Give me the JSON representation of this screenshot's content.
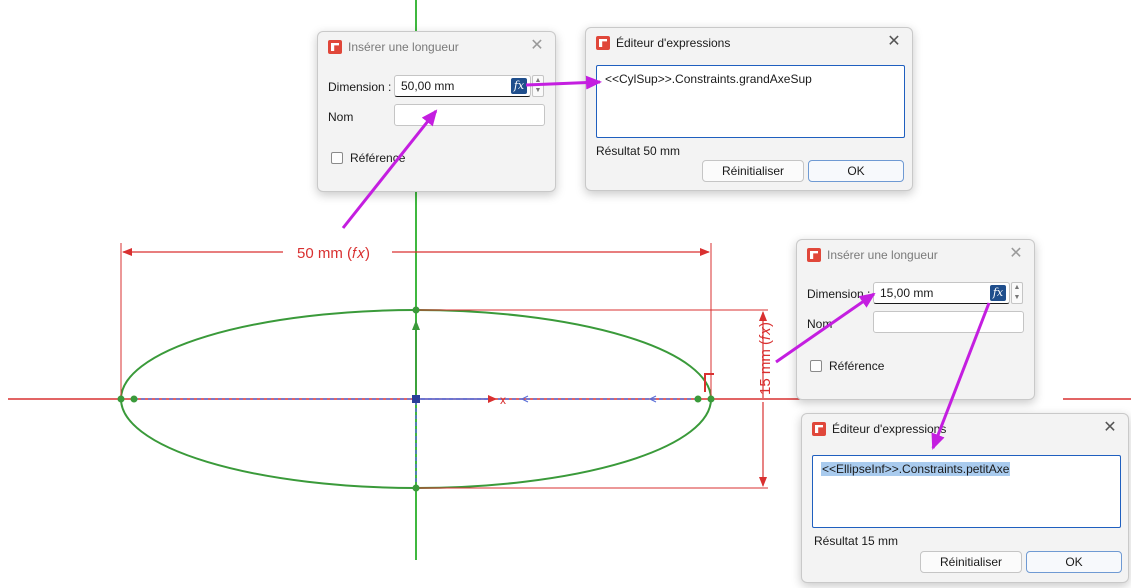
{
  "sketch": {
    "dim_horizontal_label": "50 mm (𝑓𝑥)",
    "dim_vertical_label": "15 mm (𝑓𝑥)",
    "axis_marker": "x"
  },
  "dialog_length_1": {
    "title": "Insérer une longueur",
    "dimension_label": "Dimension :",
    "dimension_value": "50,00 mm",
    "fx_label": "fx",
    "name_label": "Nom",
    "name_value": "",
    "reference_label": "Référence"
  },
  "dialog_expr_1": {
    "title": "Éditeur d'expressions",
    "expression": "<<CylSup>>.Constraints.grandAxeSup",
    "result": "Résultat 50 mm",
    "reset_button": "Réinitialiser",
    "ok_button": "OK"
  },
  "dialog_length_2": {
    "title": "Insérer une longueur",
    "dimension_label": "Dimension :",
    "dimension_value": "15,00 mm",
    "fx_label": "fx",
    "name_label": "Nom",
    "name_value": "",
    "reference_label": "Référence"
  },
  "dialog_expr_2": {
    "title": "Éditeur d'expressions",
    "expression": "<<EllipseInf>>.Constraints.petitAxe",
    "result": "Résultat 15 mm",
    "reset_button": "Réinitialiser",
    "ok_button": "OK"
  },
  "colors": {
    "ellipse": "#3a9a3a",
    "dimension": "#d93030",
    "axis_x": "#d93030",
    "axis_y": "#3fb83f",
    "annotation_arrow": "#c41ee0",
    "construction": "#5a6fd8",
    "fx_button": "#1f4e8c"
  }
}
